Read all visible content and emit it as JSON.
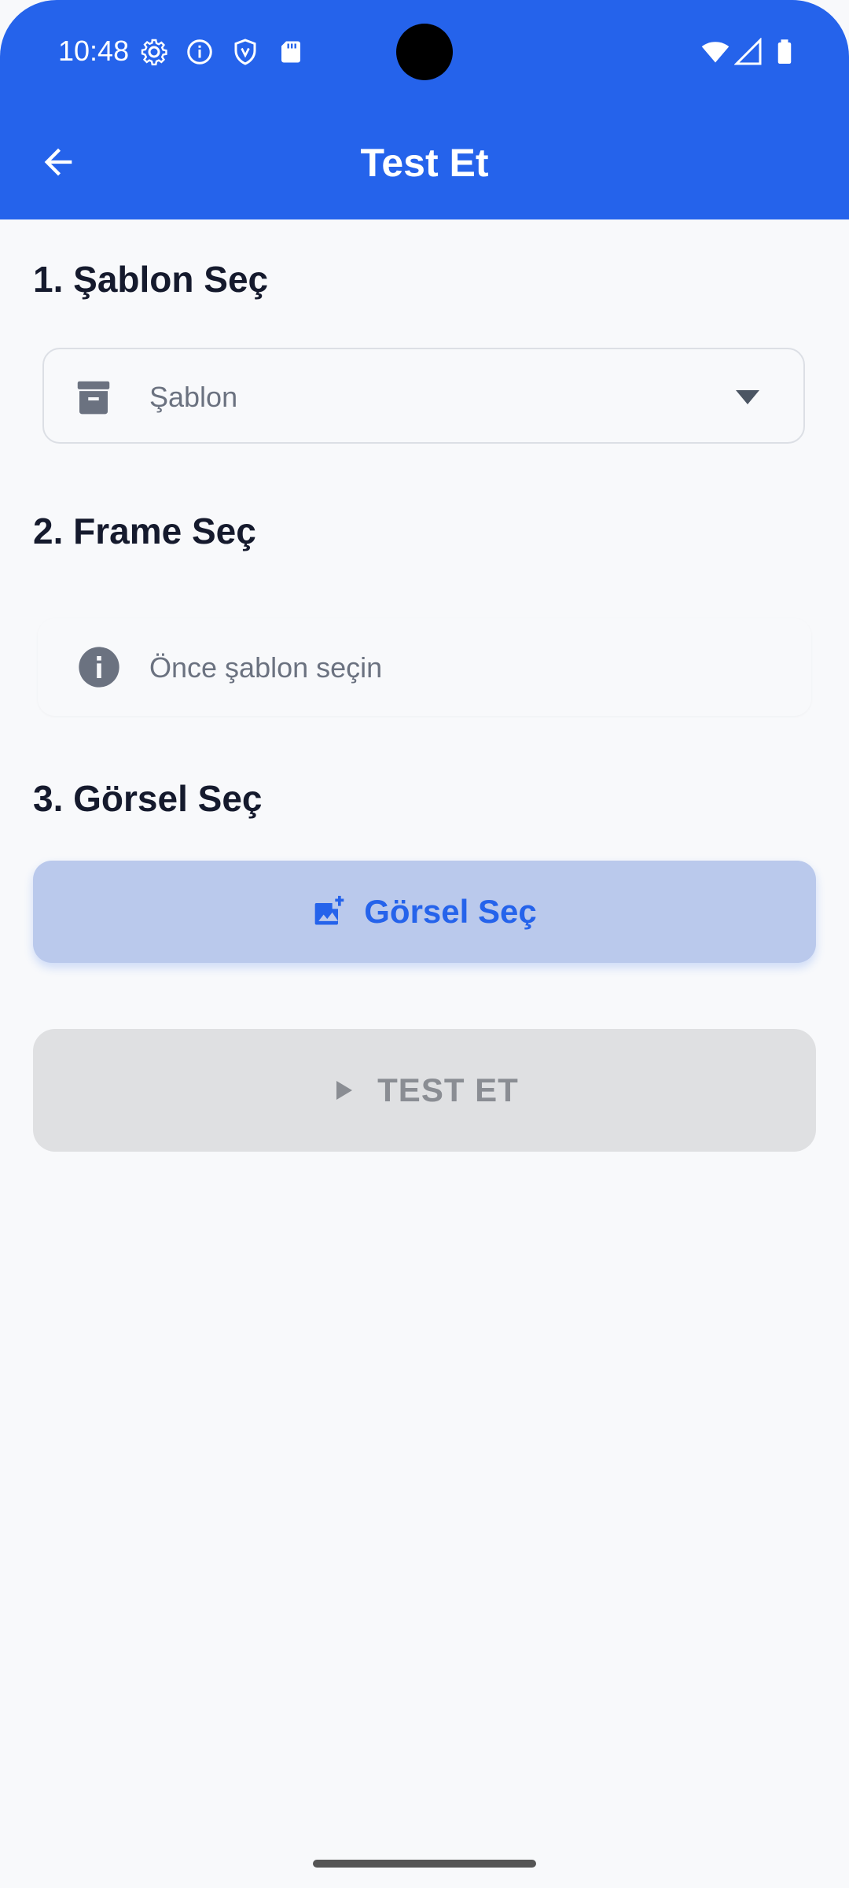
{
  "status_bar": {
    "time": "10:48",
    "left_icons": [
      "gear-icon",
      "info-icon",
      "shield-icon",
      "sd-card-icon"
    ],
    "right_icons": [
      "wifi-icon",
      "cell-signal-icon",
      "battery-icon"
    ]
  },
  "app_bar": {
    "title": "Test Et",
    "back_icon": "arrow-left-icon",
    "color": "#2563eb"
  },
  "sections": {
    "template": {
      "title": "1. Şablon Seç",
      "dropdown": {
        "placeholder": "Şablon",
        "icon": "archive-icon"
      }
    },
    "frame": {
      "title": "2. Frame Seç",
      "info_text": "Önce şablon seçin",
      "icon": "info-icon"
    },
    "image": {
      "title": "3. Görsel Seç",
      "button_label": "Görsel Seç",
      "icon": "add-photo-icon"
    }
  },
  "test_button": {
    "label": "TEST ET",
    "icon": "play-icon",
    "enabled": false
  },
  "colors": {
    "primary": "#2563eb",
    "background": "#f8f9fb",
    "disabled": "#dfe0e2",
    "text_dark": "#151a2d",
    "text_muted": "#6b7280"
  }
}
